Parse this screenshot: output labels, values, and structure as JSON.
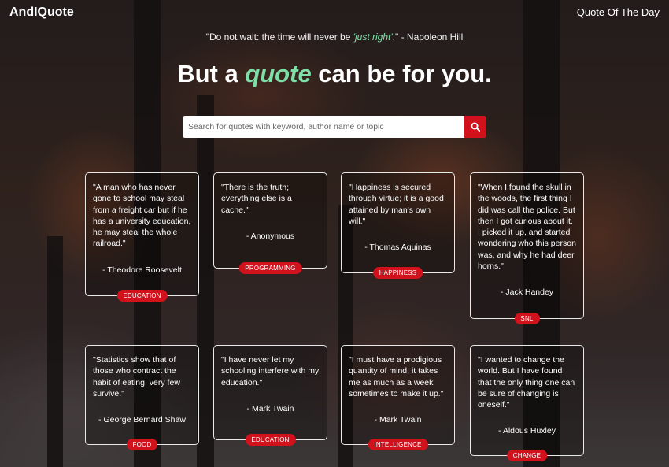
{
  "brand": "AndIQuote",
  "nav": {
    "quote_of_the_day": "Quote Of The Day"
  },
  "motto": {
    "before": "\"Do not wait: the time will never be ",
    "emphasis": "'just right'",
    "after": ".\" - Napoleon Hill"
  },
  "headline": {
    "before": "But a ",
    "accent": "quote",
    "after": " can be for you."
  },
  "search": {
    "placeholder": "Search for quotes with keyword, author name or topic",
    "value": "",
    "icon": "search-icon"
  },
  "colors": {
    "accent": "#d1111c",
    "highlight": "#7ee0a8"
  },
  "quotes": [
    {
      "text": "\"A man who has never gone to school may steal from a freight car but if he has a university education, he may steal the whole railroad.\"",
      "author": "- Theodore Roosevelt",
      "tag": "EDUCATION"
    },
    {
      "text": "\"There is the truth; everything else is a cache.\"",
      "author": "- Anonymous",
      "tag": "PROGRAMMING"
    },
    {
      "text": "\"Happiness is secured through virtue; it is a good attained by man's own will.\"",
      "author": "- Thomas Aquinas",
      "tag": "HAPPINESS"
    },
    {
      "text": "\"When I found the skull in the woods, the first thing I did was call the police. But then I got curious about it. I picked it up, and started wondering who this person was, and why he had deer horns.\"",
      "author": "- Jack Handey",
      "tag": "SNL"
    },
    {
      "text": "\"Statistics show that of those who contract the habit of eating, very few survive.\"",
      "author": "- George Bernard Shaw",
      "tag": "FOOD"
    },
    {
      "text": "\"I have never let my schooling interfere with my education.\"",
      "author": "- Mark Twain",
      "tag": "EDUCATION"
    },
    {
      "text": "\"I must have a prodigious quantity of mind; it takes me as much as a week sometimes to make it up.\"",
      "author": "- Mark Twain",
      "tag": "INTELLIGENCE"
    },
    {
      "text": "\"I wanted to change the world. But I have found that the only thing one can be sure of changing is oneself.\"",
      "author": "- Aldous Huxley",
      "tag": "CHANGE"
    }
  ]
}
